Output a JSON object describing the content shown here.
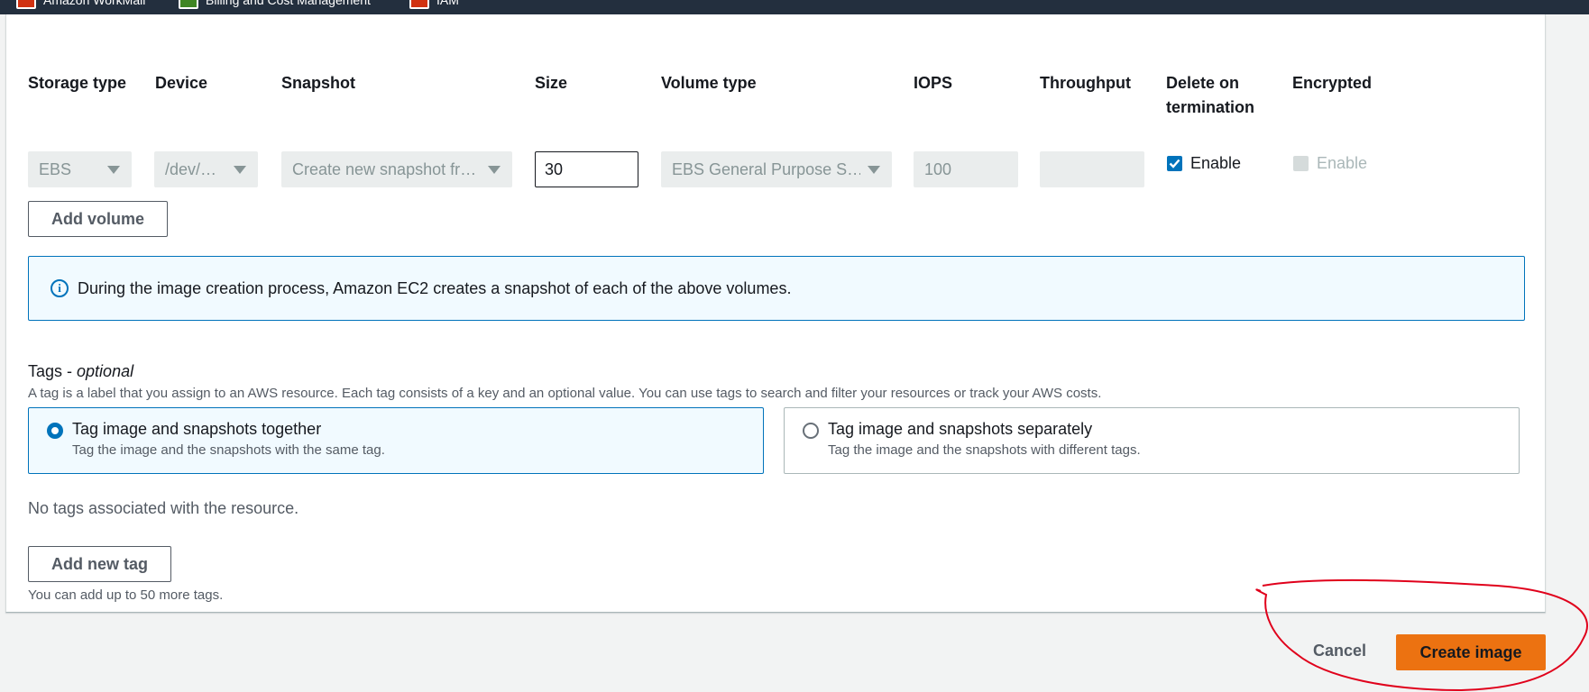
{
  "favorites_bar": {
    "items": [
      {
        "label": "Amazon WorkMail",
        "icon": "workmail-icon"
      },
      {
        "label": "Billing and Cost Management",
        "icon": "billing-icon"
      },
      {
        "label": "IAM",
        "icon": "iam-icon"
      }
    ]
  },
  "volumes": {
    "columns": [
      "Storage type",
      "Device",
      "Snapshot",
      "Size",
      "Volume type",
      "IOPS",
      "Throughput",
      "Delete on termination",
      "Encrypted"
    ],
    "row": {
      "storage_type": "EBS",
      "device": "/dev/…",
      "snapshot": "Create new snapshot fr…",
      "size": "30",
      "volume_type": "EBS General Purpose S…",
      "iops": "100",
      "throughput": "",
      "delete_on_termination": {
        "label": "Enable",
        "checked": true
      },
      "encrypted": {
        "label": "Enable",
        "checked": false,
        "disabled": true
      }
    },
    "add_volume_label": "Add volume"
  },
  "info": {
    "text": "During the image creation process, Amazon EC2 creates a snapshot of each of the above volumes."
  },
  "tags": {
    "title": "Tags - ",
    "title_optional": "optional",
    "description": "A tag is a label that you assign to an AWS resource. Each tag consists of a key and an optional value. You can use tags to search and filter your resources or track your AWS costs.",
    "options": [
      {
        "label": "Tag image and snapshots together",
        "description": "Tag the image and the snapshots with the same tag.",
        "selected": true
      },
      {
        "label": "Tag image and snapshots separately",
        "description": "Tag the image and the snapshots with different tags.",
        "selected": false
      }
    ],
    "empty_text": "No tags associated with the resource.",
    "add_tag_label": "Add new tag",
    "limit_text": "You can add up to 50 more tags."
  },
  "footer": {
    "cancel_label": "Cancel",
    "create_label": "Create image"
  },
  "colors": {
    "primary": "#ec7211",
    "info_border": "#0073bb",
    "annotation": "#e0001b"
  }
}
